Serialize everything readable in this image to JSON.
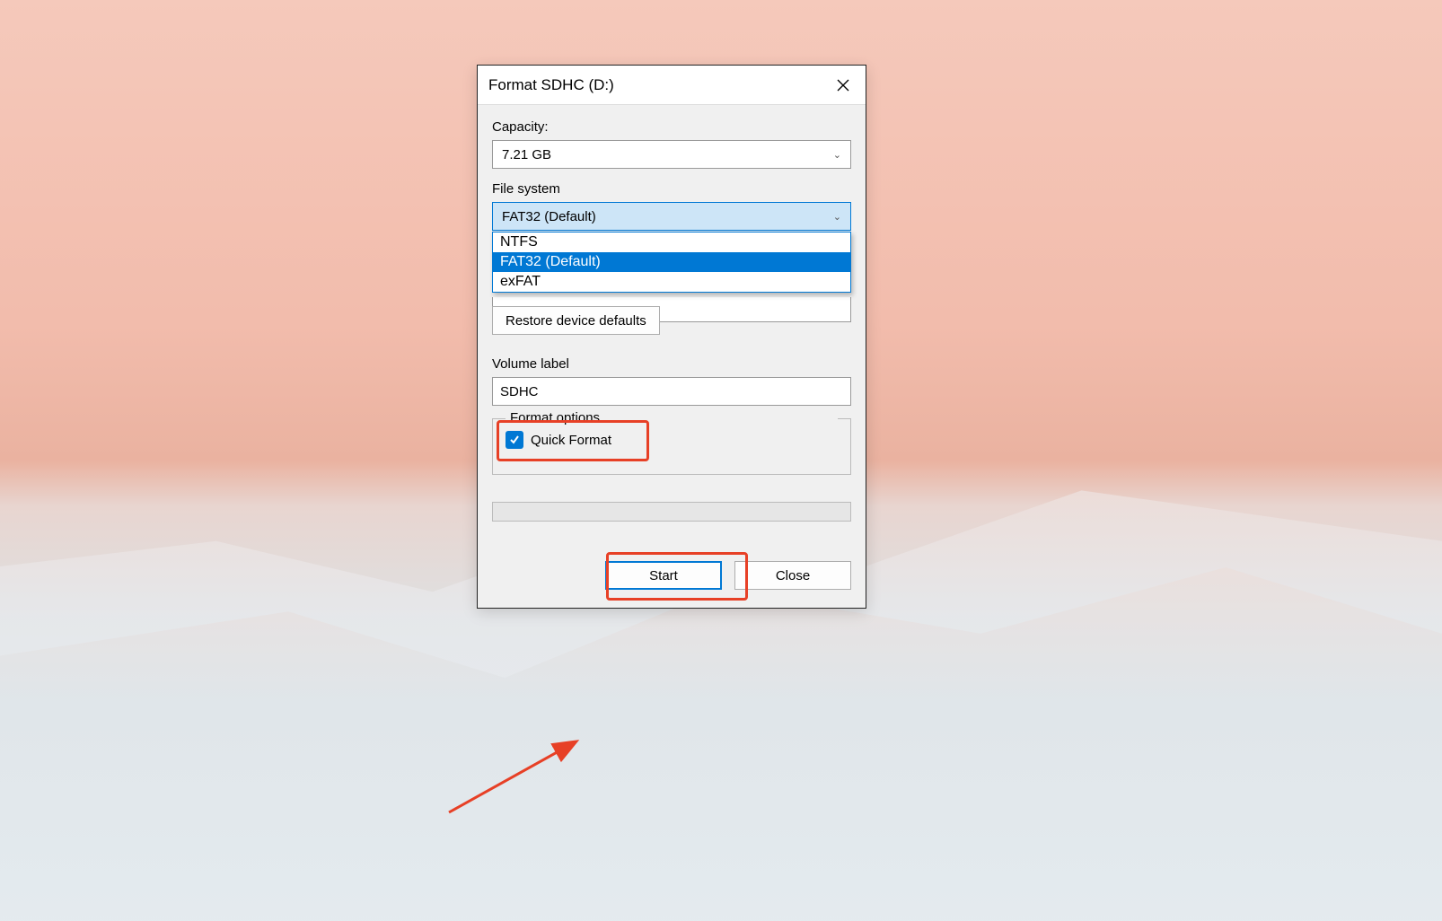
{
  "dialog": {
    "title": "Format SDHC (D:)",
    "capacity": {
      "label": "Capacity:",
      "value": "7.21 GB"
    },
    "filesystem": {
      "label": "File system",
      "value": "FAT32 (Default)",
      "options": [
        "NTFS",
        "FAT32 (Default)",
        "exFAT"
      ]
    },
    "restore_button": "Restore device defaults",
    "volume_label": {
      "label": "Volume label",
      "value": "SDHC"
    },
    "format_options": {
      "legend": "Format options",
      "quick_format": "Quick Format"
    },
    "buttons": {
      "start": "Start",
      "close": "Close"
    }
  }
}
